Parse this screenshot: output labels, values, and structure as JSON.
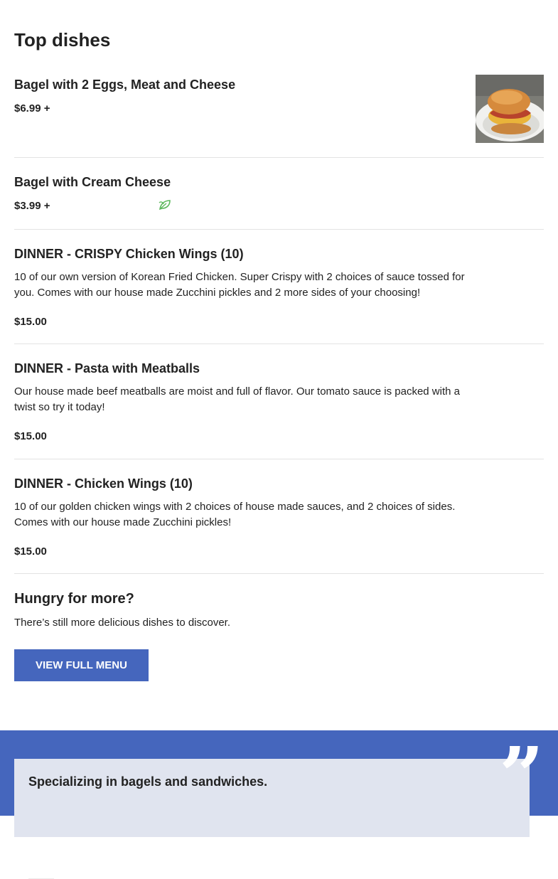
{
  "section_title": "Top dishes",
  "dishes": [
    {
      "name": "Bagel with 2 Eggs, Meat and Cheese",
      "description": "",
      "price": "$6.99 +",
      "has_image": true,
      "image_icon": "bagel-sandwich-photo"
    },
    {
      "name": "Bagel with Cream Cheese",
      "description": "",
      "price": "$3.99 +",
      "badge_icon": "leaf-icon",
      "badge_color": "#5cb85c"
    },
    {
      "name": "DINNER - CRISPY Chicken Wings (10)",
      "description": "10 of our own version of Korean Fried Chicken. Super Crispy with 2 choices of sauce tossed for you. Comes with our house made Zucchini pickles and 2 more sides of your choosing!",
      "price": "$15.00"
    },
    {
      "name": "DINNER - Pasta with Meatballs",
      "description": "Our house made beef meatballs are moist and full of flavor. Our tomato sauce is packed with a twist so try it today!",
      "price": "$15.00"
    },
    {
      "name": "DINNER - Chicken Wings (10)",
      "description": "10 of our golden chicken wings with 2 choices of house made sauces, and 2 choices of sides. Comes with our house made Zucchini pickles!",
      "price": "$15.00"
    }
  ],
  "more": {
    "title": "Hungry for more?",
    "subtitle": "There’s still more delicious dishes to discover.",
    "button_label": "VIEW FULL MENU"
  },
  "quote": {
    "text": "Specializing in bagels and sandwiches.",
    "mark": "”",
    "mark_icon": "quote-icon"
  },
  "colors": {
    "accent": "#4566bd",
    "quote_card": "#e0e4ef",
    "divider": "#e3e3e3"
  }
}
